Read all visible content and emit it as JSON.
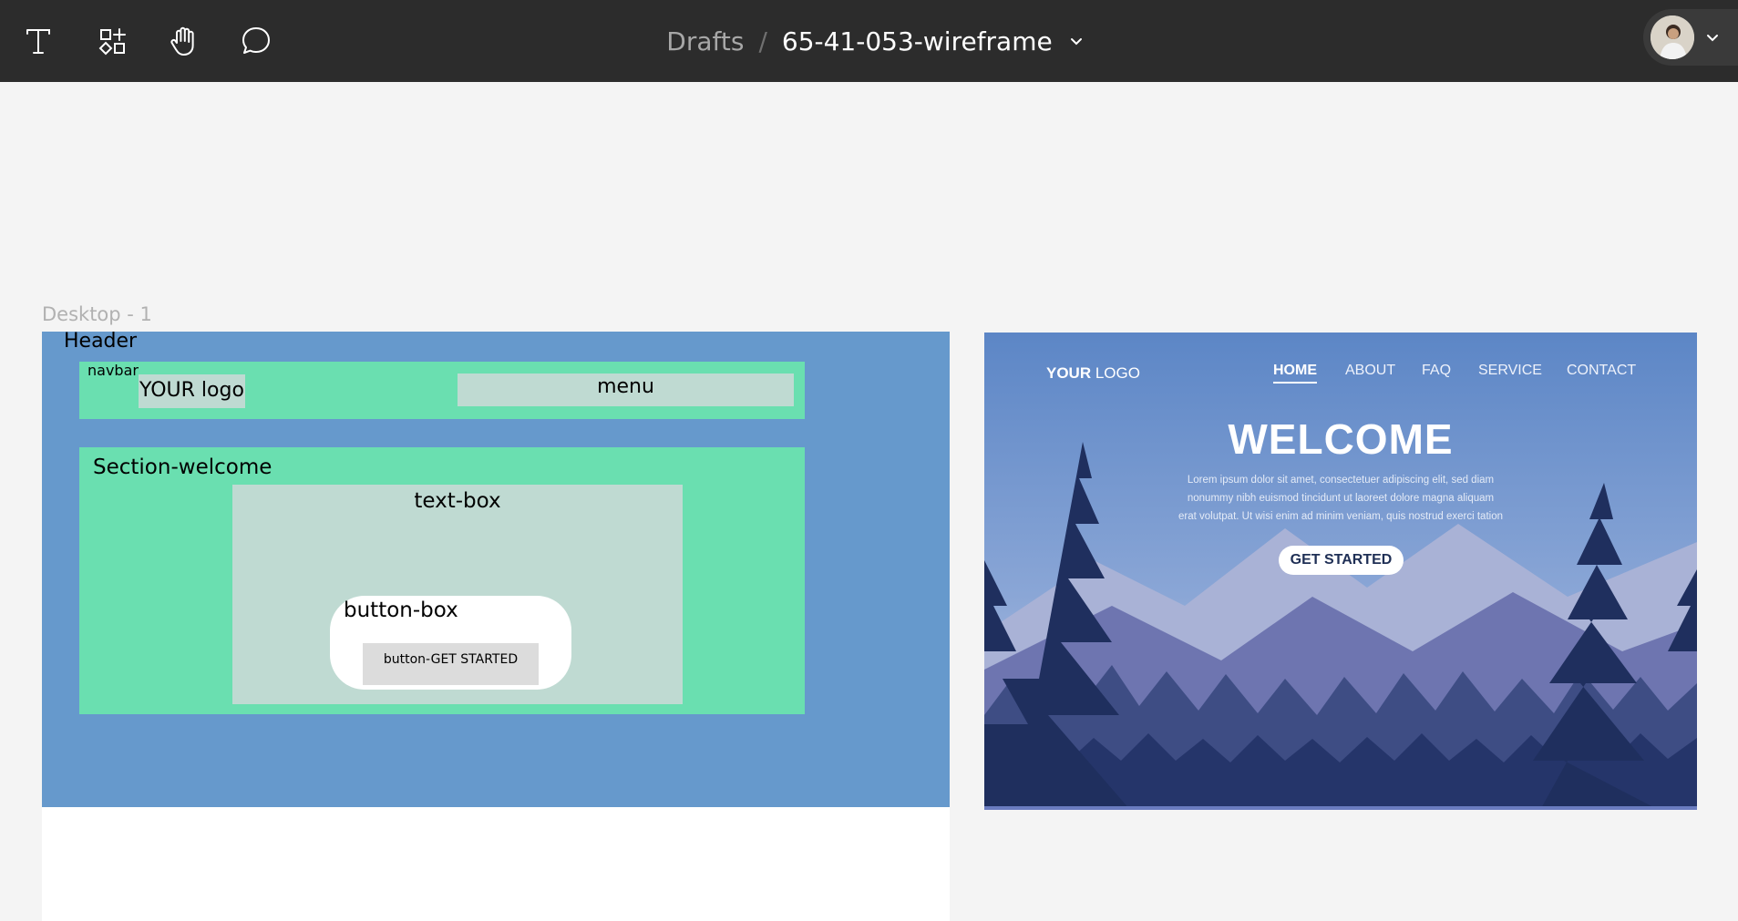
{
  "toolbar": {
    "tools": [
      {
        "name": "text-tool",
        "icon": "text-icon"
      },
      {
        "name": "resources-tool",
        "icon": "shapes-plus-icon"
      },
      {
        "name": "hand-tool",
        "icon": "hand-icon"
      },
      {
        "name": "comment-tool",
        "icon": "comment-icon"
      }
    ],
    "breadcrumb": {
      "drafts": "Drafts",
      "separator": "/",
      "file_name": "65-41-053-wireframe"
    },
    "user_menu_icon": "avatar"
  },
  "canvas": {
    "frame_title": "Desktop - 1",
    "wireframe": {
      "header": "Header",
      "navbar": "navbar",
      "logo": "YOUR logo",
      "menu": "menu",
      "section": "Section-welcome",
      "text_box": "text-box",
      "button_box": "button-box",
      "button": "button-GET STARTED"
    },
    "colors": {
      "header": "#6699cc",
      "navbar": "#6adfb0",
      "boxes": "#bfdad2",
      "button": "#dcdcdc"
    }
  },
  "reference": {
    "logo_bold": "YOUR",
    "logo_rest": " LOGO",
    "nav": [
      "HOME",
      "ABOUT",
      "FAQ",
      "SERVICE",
      "CONTACT"
    ],
    "active_nav": "HOME",
    "heading": "WELCOME",
    "body_lines": [
      "Lorem ipsum dolor sit amet, consectetuer adipiscing elit, sed diam",
      "nonummy nibh euismod tincidunt ut laoreet dolore magna aliquam",
      "erat volutpat. Ut wisi enim ad minim veniam, quis nostrud exerci tation"
    ],
    "cta": "GET STARTED"
  }
}
